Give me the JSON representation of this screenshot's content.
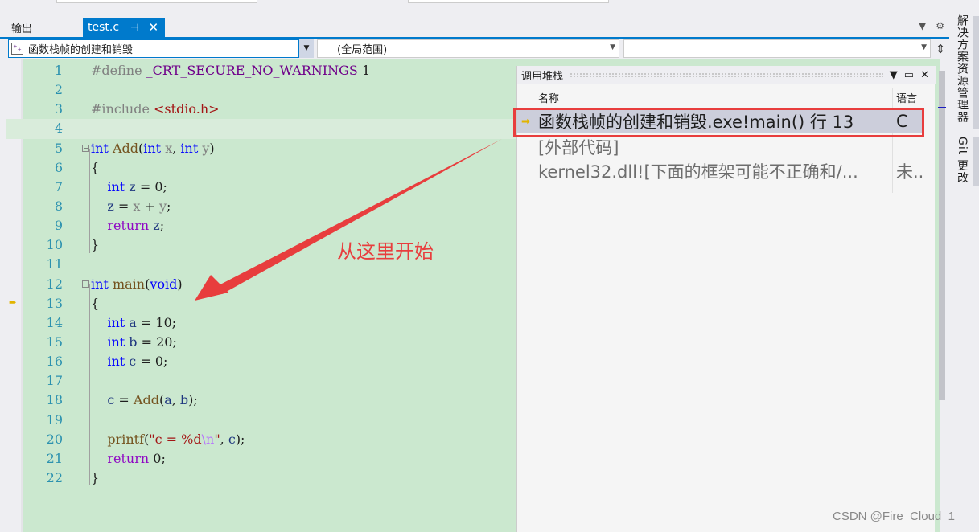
{
  "tabs": {
    "output_label": "输出",
    "active_tab": "test.c",
    "pin_icon": "⊣",
    "close_icon": "✕",
    "dropdown_icon": "▾",
    "settings_icon": "⚙"
  },
  "navbar": {
    "project": "函数栈帧的创建和销毁",
    "scope": "(全局范围)",
    "member": "",
    "split_icon": "↕"
  },
  "editor": {
    "current_line": 13,
    "lines": [
      {
        "n": "1"
      },
      {
        "n": "2"
      },
      {
        "n": "3"
      },
      {
        "n": "4"
      },
      {
        "n": "5"
      },
      {
        "n": "6"
      },
      {
        "n": "7"
      },
      {
        "n": "8"
      },
      {
        "n": "9"
      },
      {
        "n": "10"
      },
      {
        "n": "11"
      },
      {
        "n": "12"
      },
      {
        "n": "13"
      },
      {
        "n": "14"
      },
      {
        "n": "15"
      },
      {
        "n": "16"
      },
      {
        "n": "17"
      },
      {
        "n": "18"
      },
      {
        "n": "19"
      },
      {
        "n": "20"
      },
      {
        "n": "21"
      },
      {
        "n": "22"
      }
    ],
    "tokens": {
      "define": "#define",
      "macro": "_CRT_SECURE_NO_WARNINGS",
      "one": "1",
      "include": "#include",
      "header": "<stdio.h>",
      "int": "int",
      "add": "Add",
      "x": "x",
      "y": "y",
      "z": "z",
      "zero": "0",
      "ret": "return",
      "main": "main",
      "void": "void",
      "a": "a",
      "b": "b",
      "c": "c",
      "ten": "10",
      "twenty": "20",
      "printf": "printf",
      "fmt": "\"c = %d",
      "esc": "\\n",
      "quote": "\""
    }
  },
  "callstack": {
    "title": "调用堆栈",
    "col_name": "名称",
    "col_lang": "语言",
    "rows": [
      {
        "name": "函数栈帧的创建和销毁.exe!main() 行 13",
        "lang": "C"
      },
      {
        "name": "[外部代码]",
        "lang": ""
      },
      {
        "name": "kernel32.dll![下面的框架可能不正确和/...",
        "lang": "未.."
      }
    ]
  },
  "side_tabs": {
    "solution_explorer": "解决方案资源管理器",
    "git_changes": "Git 更改"
  },
  "annotation": {
    "text": "从这里开始",
    "color": "#e83d3d"
  },
  "watermark": "CSDN @Fire_Cloud_1"
}
